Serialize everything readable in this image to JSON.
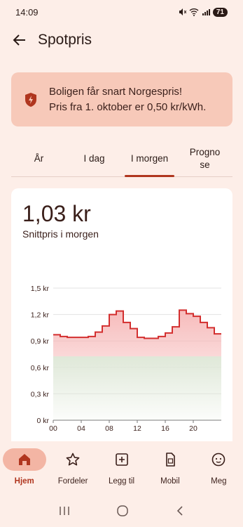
{
  "status": {
    "time": "14:09",
    "battery": "71"
  },
  "appbar": {
    "title": "Spotpris"
  },
  "banner": {
    "title": "Boligen får snart Norgespris!",
    "text": "Pris fra 1. oktober er 0,50 kr/kWh."
  },
  "tabs": [
    {
      "label": "År",
      "active": false
    },
    {
      "label": "I dag",
      "active": false
    },
    {
      "label": "I morgen",
      "active": true
    },
    {
      "label": "Progno se",
      "active": false
    }
  ],
  "summary": {
    "price": "1,03 kr",
    "subtitle": "Snittpris i morgen"
  },
  "chart_data": {
    "type": "line",
    "style": "step",
    "xlabel": "",
    "ylabel": "",
    "x_ticks": [
      "00",
      "04",
      "08",
      "12",
      "16",
      "20"
    ],
    "y_ticks": [
      "0 kr",
      "0,3 kr",
      "0,6 kr",
      "0,9 kr",
      "1,2 kr",
      "1,5 kr"
    ],
    "ylim": [
      0,
      1.5
    ],
    "xlim": [
      0,
      24
    ],
    "hours": [
      0,
      1,
      2,
      3,
      4,
      5,
      6,
      7,
      8,
      9,
      10,
      11,
      12,
      13,
      14,
      15,
      16,
      17,
      18,
      19,
      20,
      21,
      22,
      23
    ],
    "values": [
      0.97,
      0.95,
      0.94,
      0.94,
      0.94,
      0.95,
      1.0,
      1.07,
      1.2,
      1.24,
      1.11,
      1.04,
      0.94,
      0.93,
      0.93,
      0.95,
      0.99,
      1.06,
      1.25,
      1.21,
      1.18,
      1.11,
      1.05,
      0.98
    ],
    "line_color": "#d32f2f",
    "fill_above": "#f6b8b8",
    "fill_below": "#dfe8d8",
    "grid": true
  },
  "bottomnav": [
    {
      "label": "Hjem",
      "icon": "home-icon",
      "active": true
    },
    {
      "label": "Fordeler",
      "icon": "star-icon",
      "active": false
    },
    {
      "label": "Legg til",
      "icon": "add-box-icon",
      "active": false
    },
    {
      "label": "Mobil",
      "icon": "sim-card-icon",
      "active": false
    },
    {
      "label": "Meg",
      "icon": "face-icon",
      "active": false
    }
  ],
  "colors": {
    "accent": "#b0361f",
    "background": "#fdeee8",
    "banner": "#f7c9b9"
  }
}
